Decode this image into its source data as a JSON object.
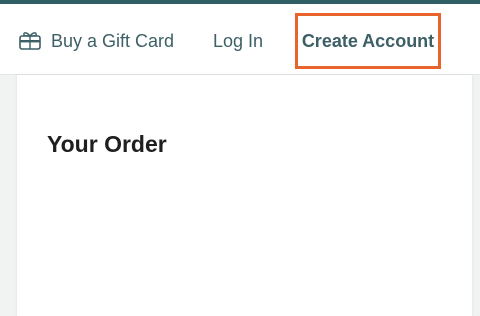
{
  "header": {
    "gift_card_label": "Buy a Gift Card",
    "gift_icon": "gift-card-icon",
    "login_label": "Log In",
    "create_account_label": "Create Account"
  },
  "order": {
    "title": "Your Order"
  },
  "colors": {
    "accent": "#2f5f63",
    "link": "#3d5f66",
    "highlight": "#e8642c"
  }
}
